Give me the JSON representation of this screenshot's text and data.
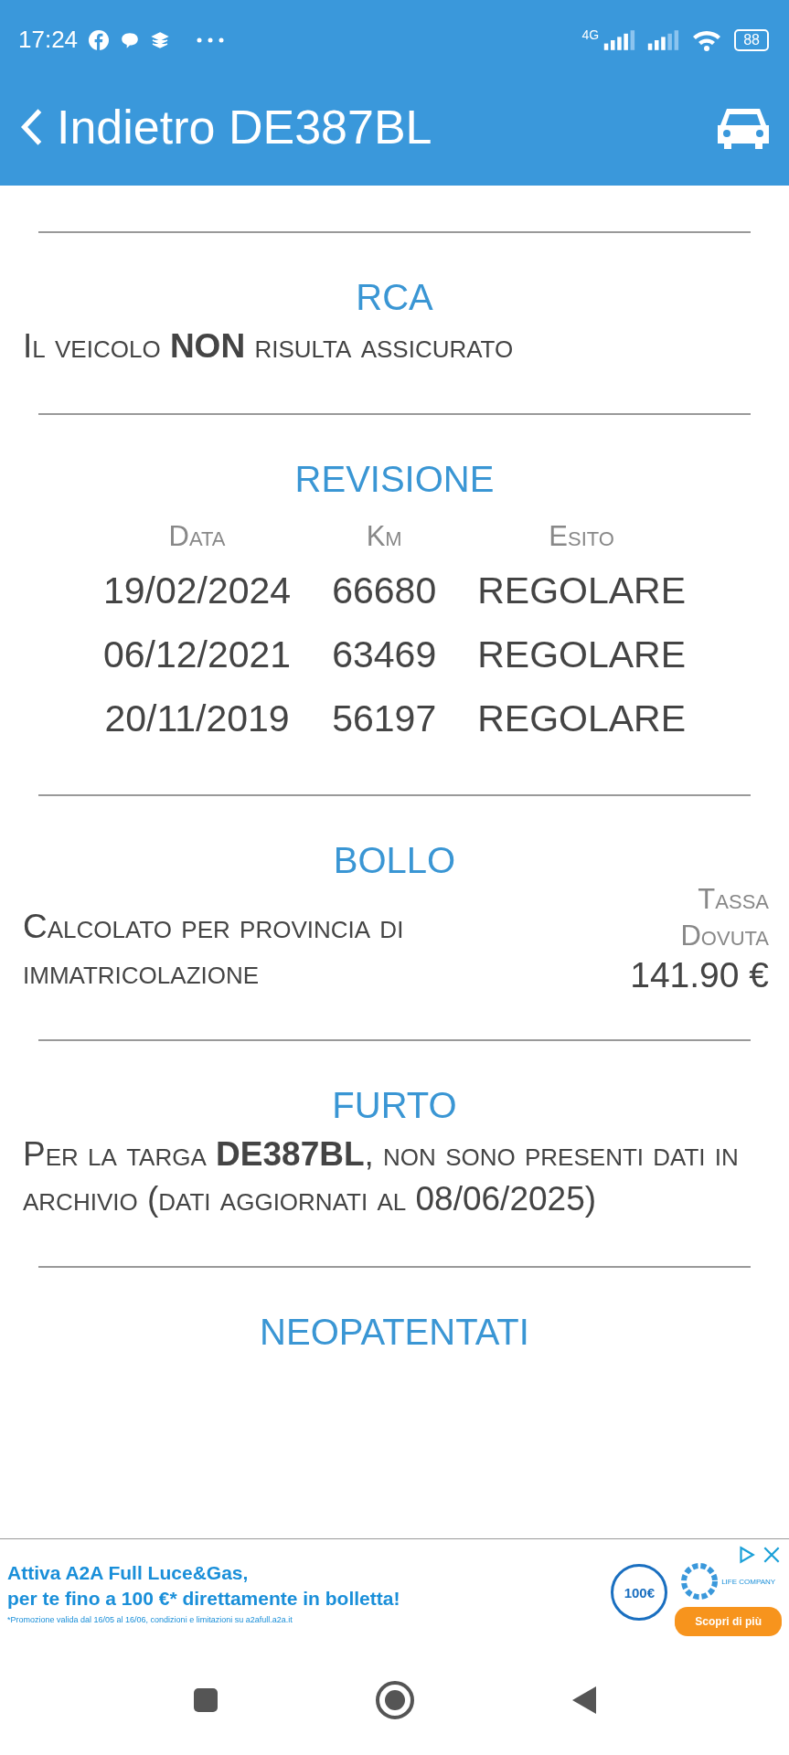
{
  "status_bar": {
    "time": "17:24",
    "network": "4G",
    "battery": "88"
  },
  "header": {
    "back_label": "Indietro DE387BL"
  },
  "sections": [
    {
      "kind": "text",
      "title": "RCA",
      "text": "Il veicolo **NON** risulta assicurato"
    },
    {
      "kind": "table",
      "title": "REVISIONE",
      "columns": [
        "Data",
        "Km",
        "Esito"
      ],
      "rows": [
        [
          "19/02/2024",
          "66680",
          "REGOLARE"
        ],
        [
          "06/12/2021",
          "63469",
          "REGOLARE"
        ],
        [
          "20/11/2019",
          "56197",
          "REGOLARE"
        ]
      ]
    },
    {
      "kind": "tax",
      "title": "BOLLO",
      "text": "Calcolato per provincia di immatricolazione",
      "label": "Tassa Dovuta",
      "amount": "141.90 €"
    },
    {
      "kind": "text",
      "title": "FURTO",
      "text": "Per la targa **DE387BL**, non sono presenti dati in archivio (dati aggiornati al 08/06/2025)"
    },
    {
      "kind": "heading",
      "title": "NEOPATENTATI"
    }
  ],
  "ad": {
    "headline": "Attiva A2A Full Luce&Gas,",
    "subline": "per te fino a 100 €* direttamente in bolletta!",
    "disclaimer": "*Promozione valida dal 16/05 al 16/06, condizioni e limitazioni su a2afull.a2a.it",
    "badge": "100€",
    "tagline": "LIFE COMPANY",
    "cta": "Scopri di più"
  }
}
